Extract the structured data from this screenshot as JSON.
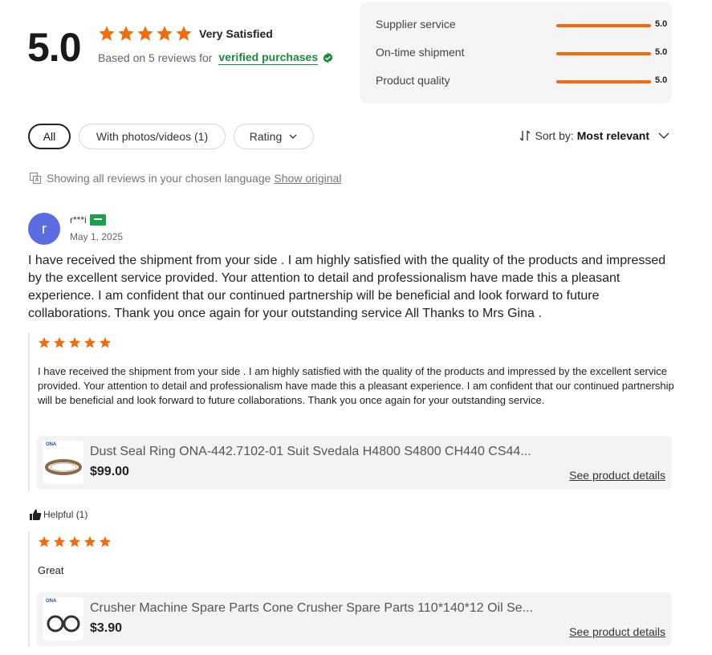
{
  "summary": {
    "score": "5.0",
    "rating_label": "Very Satisfied",
    "based_on": "Based on 5 reviews for",
    "verified": "verified purchases",
    "star_count": 5
  },
  "metrics": [
    {
      "label": "Supplier service",
      "value": "5.0",
      "fraction": 1.0
    },
    {
      "label": "On-time shipment",
      "value": "5.0",
      "fraction": 1.0
    },
    {
      "label": "Product quality",
      "value": "5.0",
      "fraction": 1.0
    }
  ],
  "filters": {
    "all": "All",
    "photos": "With photos/videos (1)",
    "rating": "Rating"
  },
  "sort": {
    "label": "Sort by:",
    "value": "Most relevant"
  },
  "language": {
    "notice": "Showing all reviews in your chosen language",
    "show_original": "Show original"
  },
  "review": {
    "avatar_letter": "r",
    "username": "r***i",
    "date": "May 1, 2025",
    "text": "I have received the shipment from your side . I am highly satisfied with the quality of the products and impressed by the excellent service provided. Your attention to detail and professionalism have made this a pleasant experience. I am confident that our continued partnership will be beneficial and look forward to future collaborations. Thank you once again for your outstanding service All Thanks to Mrs Gina .",
    "sub_reviews": [
      {
        "stars": 5,
        "text": "I have received the shipment from your side . I am highly satisfied with the quality of the products and impressed by the excellent service provided. Your attention to detail and professionalism have made this a pleasant experience. I am confident that our continued partnership will be beneficial and look forward to future collaborations. Thank you once again for your outstanding service.",
        "product": {
          "brand": "ONA",
          "title": "Dust Seal Ring ONA-442.7102-01 Suit Svedala H4800 S4800 CH440 CS44...",
          "price": "$99.00",
          "link": "See product details"
        }
      },
      {
        "stars": 5,
        "text": "Great",
        "product": {
          "brand": "ONA",
          "title": "Crusher Machine Spare Parts Cone Crusher Spare Parts 110*140*12 Oil Se...",
          "price": "$3.90",
          "link": "See product details"
        }
      }
    ],
    "helpful": "Helpful (1)"
  },
  "colors": {
    "star": "#f26c0d",
    "verified": "#1a8a3a",
    "avatar": "#5b6ee1"
  }
}
